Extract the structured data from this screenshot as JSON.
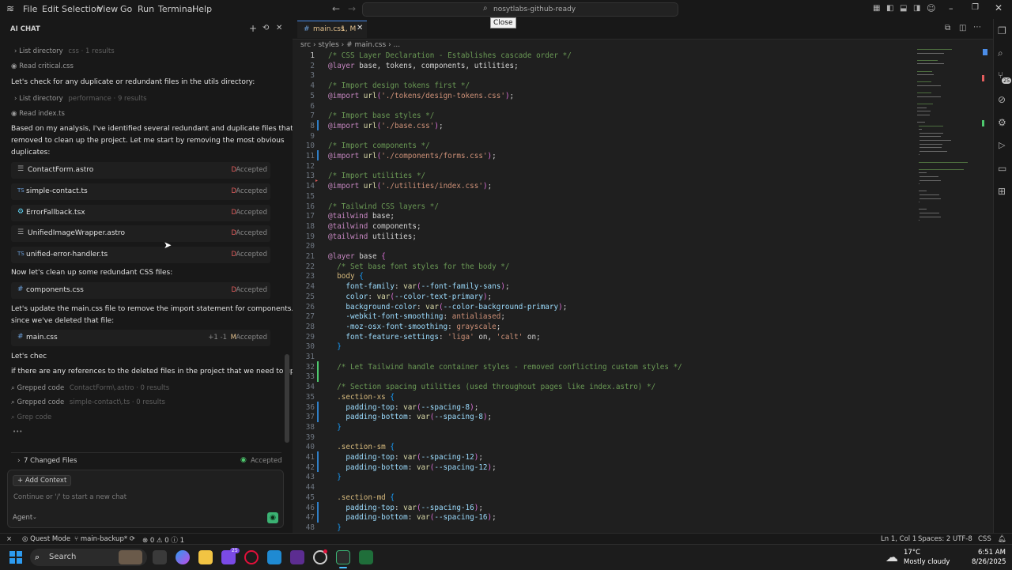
{
  "menu": [
    "File",
    "Edit",
    "Selection",
    "View",
    "Go",
    "Run",
    "Terminal",
    "Help"
  ],
  "search": {
    "text": "nosytlabs-github-ready"
  },
  "tooltip": "Close",
  "chat": {
    "title": "AI CHAT",
    "lines": {
      "list_dir_1": "List directory",
      "list_dir_1_sub": "css · 1 results",
      "read_critical": "Read critical.css",
      "check_dup": "Let's check for any duplicate or redundant files in the utils directory:",
      "list_dir_2": "List directory",
      "list_dir_2_sub": "performance · 9 results",
      "read_index": "Read index.ts",
      "analysis_1": "Based on my analysis, I've identified several redundant and duplicate files that can be",
      "analysis_2": "removed to clean up the project. Let me start by removing the most obvious",
      "analysis_3": "duplicates:",
      "clean_css": "Now let's clean up some redundant CSS files:",
      "update_1": "Let's update the main.css file to remove the import statement for components.css",
      "update_2": "since we've deleted that file:",
      "lets_chec": "Let's chec",
      "refs": "if there are any references to the deleted files in the project that we need to update:",
      "grep1": "Grepped code",
      "grep1_sub": "ContactForm\\.astro · 0 results",
      "grep2": "Grepped code",
      "grep2_sub": "simple-contact\\.ts · 0 results",
      "grep3": "Grep code",
      "ellipsis": "•••"
    },
    "files": [
      {
        "icon": "☰",
        "name": "ContactForm.astro",
        "mark": "D",
        "status": "Accepted"
      },
      {
        "icon": "TS",
        "name": "simple-contact.ts",
        "mark": "D",
        "status": "Accepted"
      },
      {
        "icon": "⚙",
        "name": "ErrorFallback.tsx",
        "mark": "D",
        "status": "Accepted"
      },
      {
        "icon": "☰",
        "name": "UnifiedImageWrapper.astro",
        "mark": "D",
        "status": "Accepted"
      },
      {
        "icon": "TS",
        "name": "unified-error-handler.ts",
        "mark": "D",
        "status": "Accepted"
      },
      {
        "icon": "#",
        "name": "components.css",
        "mark": "D",
        "status": "Accepted"
      },
      {
        "icon": "#",
        "name": "main.css",
        "diff": "+1 -1",
        "mark": "M",
        "status": "Accepted"
      }
    ],
    "changed_files": "7 Changed Files",
    "changed_status": "Accepted",
    "add_context": "+ Add Context",
    "placeholder": "Continue or '/' to start a new chat",
    "agent": "Agent"
  },
  "editor": {
    "tab": {
      "icon": "#",
      "name": "main.css",
      "badge": "1, M"
    },
    "breadcrumb": [
      "src",
      "styles",
      "# main.css",
      "..."
    ]
  },
  "code": [
    [
      [
        "c-com",
        "/* CSS Layer Declaration - Establishes cascade order */"
      ]
    ],
    [
      [
        "c-at",
        "@layer"
      ],
      [
        "c-plain",
        " base, tokens, components, utilities;"
      ]
    ],
    [],
    [
      [
        "c-com",
        "/* Import design tokens first */"
      ]
    ],
    [
      [
        "c-at",
        "@import"
      ],
      [
        "c-plain",
        " "
      ],
      [
        "c-fn",
        "url"
      ],
      [
        "c-br",
        "("
      ],
      [
        "c-str",
        "'./tokens/design-tokens.css'"
      ],
      [
        "c-br",
        ")"
      ],
      [
        "c-plain",
        ";"
      ]
    ],
    [],
    [
      [
        "c-com",
        "/* Import base styles */"
      ]
    ],
    [
      [
        "c-at",
        "@import"
      ],
      [
        "c-plain",
        " "
      ],
      [
        "c-fn",
        "url"
      ],
      [
        "c-br",
        "("
      ],
      [
        "c-str",
        "'./base.css'"
      ],
      [
        "c-br",
        ")"
      ],
      [
        "c-plain",
        ";"
      ]
    ],
    [],
    [
      [
        "c-com",
        "/* Import components */"
      ]
    ],
    [
      [
        "c-at",
        "@import"
      ],
      [
        "c-plain",
        " "
      ],
      [
        "c-fn",
        "url"
      ],
      [
        "c-br",
        "("
      ],
      [
        "c-str",
        "'./components/forms.css'"
      ],
      [
        "c-br",
        ")"
      ],
      [
        "c-plain",
        ";"
      ]
    ],
    [],
    [
      [
        "c-com",
        "/* Import utilities */"
      ]
    ],
    [
      [
        "c-at",
        "@import"
      ],
      [
        "c-plain",
        " "
      ],
      [
        "c-fn",
        "url"
      ],
      [
        "c-br",
        "("
      ],
      [
        "c-str",
        "'./utilities/index.css'"
      ],
      [
        "c-br",
        ")"
      ],
      [
        "c-plain",
        ";"
      ]
    ],
    [],
    [
      [
        "c-com",
        "/* Tailwind CSS layers */"
      ]
    ],
    [
      [
        "c-at",
        "@tailwind"
      ],
      [
        "c-plain",
        " base;"
      ]
    ],
    [
      [
        "c-at",
        "@tailwind"
      ],
      [
        "c-plain",
        " components;"
      ]
    ],
    [
      [
        "c-at",
        "@tailwind"
      ],
      [
        "c-plain",
        " utilities;"
      ]
    ],
    [],
    [
      [
        "c-at",
        "@layer"
      ],
      [
        "c-plain",
        " base "
      ],
      [
        "c-br",
        "{"
      ]
    ],
    [
      [
        "c-com",
        "  /* Set base font styles for the body */"
      ]
    ],
    [
      [
        "c-sel",
        "  body "
      ],
      [
        "c-brb",
        "{"
      ]
    ],
    [
      [
        "c-prop",
        "    font-family"
      ],
      [
        "c-plain",
        ": "
      ],
      [
        "c-fn",
        "var"
      ],
      [
        "c-br",
        "("
      ],
      [
        "c-var",
        "--font-family-sans"
      ],
      [
        "c-br",
        ")"
      ],
      [
        "c-plain",
        ";"
      ]
    ],
    [
      [
        "c-prop",
        "    color"
      ],
      [
        "c-plain",
        ": "
      ],
      [
        "c-fn",
        "var"
      ],
      [
        "c-br",
        "("
      ],
      [
        "c-var",
        "--color-text-primary"
      ],
      [
        "c-br",
        ")"
      ],
      [
        "c-plain",
        ";"
      ]
    ],
    [
      [
        "c-prop",
        "    background-color"
      ],
      [
        "c-plain",
        ": "
      ],
      [
        "c-fn",
        "var"
      ],
      [
        "c-br",
        "("
      ],
      [
        "c-var",
        "--color-background-primary"
      ],
      [
        "c-br",
        ")"
      ],
      [
        "c-plain",
        ";"
      ]
    ],
    [
      [
        "c-prop",
        "    -webkit-font-smoothing"
      ],
      [
        "c-plain",
        ": "
      ],
      [
        "c-str",
        "antialiased"
      ],
      [
        "c-plain",
        ";"
      ]
    ],
    [
      [
        "c-prop",
        "    -moz-osx-font-smoothing"
      ],
      [
        "c-plain",
        ": "
      ],
      [
        "c-str",
        "grayscale"
      ],
      [
        "c-plain",
        ";"
      ]
    ],
    [
      [
        "c-prop",
        "    font-feature-settings"
      ],
      [
        "c-plain",
        ": "
      ],
      [
        "c-str",
        "'liga'"
      ],
      [
        "c-plain",
        " on, "
      ],
      [
        "c-str",
        "'calt'"
      ],
      [
        "c-plain",
        " on;"
      ]
    ],
    [
      [
        "c-brb",
        "  }"
      ]
    ],
    [],
    [
      [
        "c-com",
        "  /* Let Tailwind handle container styles - removed conflicting custom styles */"
      ]
    ],
    [],
    [
      [
        "c-com",
        "  /* Section spacing utilities (used throughout pages like index.astro) */"
      ]
    ],
    [
      [
        "c-sel",
        "  .section-xs "
      ],
      [
        "c-brb",
        "{"
      ]
    ],
    [
      [
        "c-prop",
        "    padding-top"
      ],
      [
        "c-plain",
        ": "
      ],
      [
        "c-fn",
        "var"
      ],
      [
        "c-br",
        "("
      ],
      [
        "c-var",
        "--spacing-8"
      ],
      [
        "c-br",
        ")"
      ],
      [
        "c-plain",
        ";"
      ]
    ],
    [
      [
        "c-prop",
        "    padding-bottom"
      ],
      [
        "c-plain",
        ": "
      ],
      [
        "c-fn",
        "var"
      ],
      [
        "c-br",
        "("
      ],
      [
        "c-var",
        "--spacing-8"
      ],
      [
        "c-br",
        ")"
      ],
      [
        "c-plain",
        ";"
      ]
    ],
    [
      [
        "c-brb",
        "  }"
      ]
    ],
    [],
    [
      [
        "c-sel",
        "  .section-sm "
      ],
      [
        "c-brb",
        "{"
      ]
    ],
    [
      [
        "c-prop",
        "    padding-top"
      ],
      [
        "c-plain",
        ": "
      ],
      [
        "c-fn",
        "var"
      ],
      [
        "c-br",
        "("
      ],
      [
        "c-var",
        "--spacing-12"
      ],
      [
        "c-br",
        ")"
      ],
      [
        "c-plain",
        ";"
      ]
    ],
    [
      [
        "c-prop",
        "    padding-bottom"
      ],
      [
        "c-plain",
        ": "
      ],
      [
        "c-fn",
        "var"
      ],
      [
        "c-br",
        "("
      ],
      [
        "c-var",
        "--spacing-12"
      ],
      [
        "c-br",
        ")"
      ],
      [
        "c-plain",
        ";"
      ]
    ],
    [
      [
        "c-brb",
        "  }"
      ]
    ],
    [],
    [
      [
        "c-sel",
        "  .section-md "
      ],
      [
        "c-brb",
        "{"
      ]
    ],
    [
      [
        "c-prop",
        "    padding-top"
      ],
      [
        "c-plain",
        ": "
      ],
      [
        "c-fn",
        "var"
      ],
      [
        "c-br",
        "("
      ],
      [
        "c-var",
        "--spacing-16"
      ],
      [
        "c-br",
        ")"
      ],
      [
        "c-plain",
        ";"
      ]
    ],
    [
      [
        "c-prop",
        "    padding-bottom"
      ],
      [
        "c-plain",
        ": "
      ],
      [
        "c-fn",
        "var"
      ],
      [
        "c-br",
        "("
      ],
      [
        "c-var",
        "--spacing-16"
      ],
      [
        "c-br",
        ")"
      ],
      [
        "c-plain",
        ";"
      ]
    ],
    [
      [
        "c-brb",
        "  }"
      ]
    ]
  ],
  "status": {
    "quest": "Quest Mode",
    "branch": "main-backup*",
    "problems": "⊗ 0 ⚠ 0 ⓘ 1",
    "position": "Ln 1, Col 1",
    "spaces": "Spaces: 2",
    "encoding": "UTF-8",
    "language": "CSS"
  },
  "taskbar": {
    "search": "Search",
    "temp": "17°C",
    "weather": "Mostly cloudy",
    "time": "6:51 AM",
    "date": "8/26/2025",
    "badge": "25"
  },
  "colors": {
    "accent": "#4b8de8",
    "deleted": "#e35d5d",
    "modified": "#e2c08d",
    "accepted": "#8a8a8a"
  }
}
